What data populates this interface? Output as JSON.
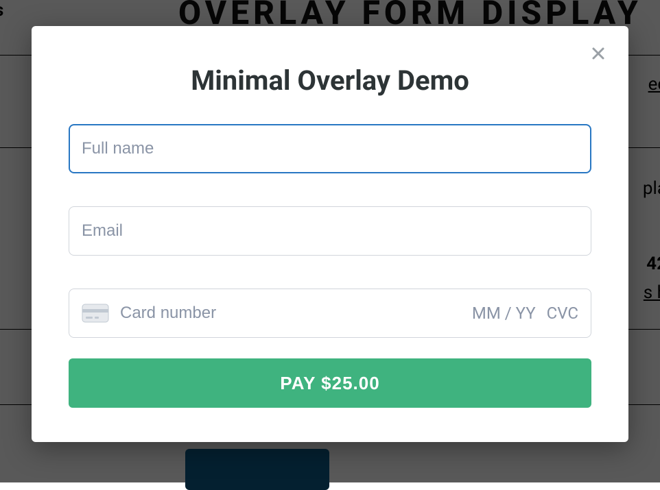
{
  "background": {
    "heading": "OVERLAY FORM DISPLAY",
    "frag1": "s",
    "frag2": "ec",
    "frag3": "pla",
    "frag4": "42",
    "frag5": "s h"
  },
  "modal": {
    "title": "Minimal Overlay Demo",
    "fullname_placeholder": "Full name",
    "email_placeholder": "Email",
    "card_placeholder": "Card number",
    "exp_placeholder": "MM / YY",
    "cvc_placeholder": "CVC",
    "pay_label": "PAY $25.00"
  }
}
